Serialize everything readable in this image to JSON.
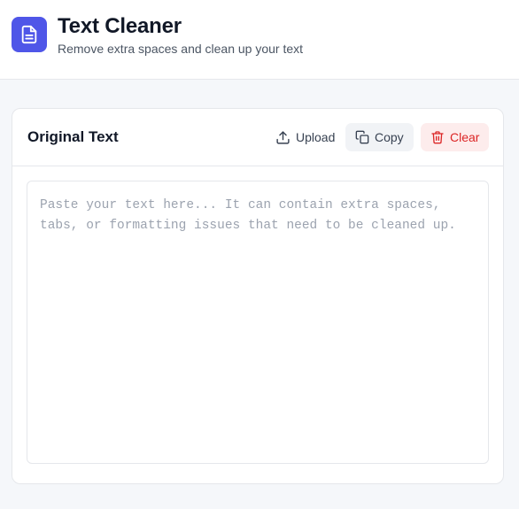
{
  "header": {
    "title": "Text Cleaner",
    "subtitle": "Remove extra spaces and clean up your text",
    "logo_icon": "document-icon"
  },
  "card": {
    "title": "Original Text",
    "buttons": {
      "upload": {
        "label": "Upload",
        "icon": "upload-icon"
      },
      "copy": {
        "label": "Copy",
        "icon": "copy-icon"
      },
      "clear": {
        "label": "Clear",
        "icon": "trash-icon"
      }
    },
    "textarea": {
      "value": "",
      "placeholder": "Paste your text here... It can contain extra spaces, tabs, or formatting issues that need to be cleaned up."
    }
  },
  "colors": {
    "accent": "#4f56e8",
    "danger": "#dc2626",
    "danger_bg": "#fdecec",
    "page_bg": "#f5f7fa"
  }
}
